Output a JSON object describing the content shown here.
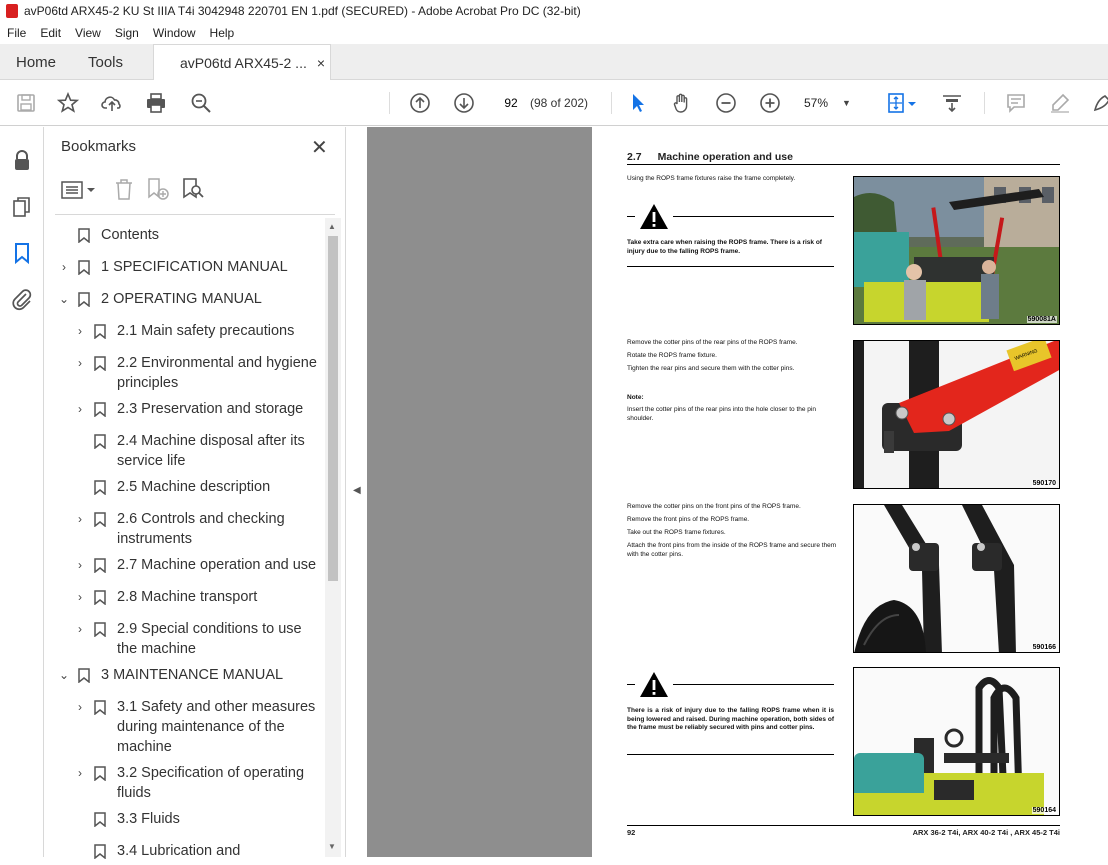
{
  "window": {
    "title": "avP06td ARX45-2 KU St IIIA T4i 3042948 220701 EN 1.pdf (SECURED) - Adobe Acrobat Pro DC (32-bit)"
  },
  "menu": [
    "File",
    "Edit",
    "View",
    "Sign",
    "Window",
    "Help"
  ],
  "tabs": {
    "home": "Home",
    "tools": "Tools",
    "document": "avP06td ARX45-2 ...",
    "close_glyph": "×"
  },
  "toolbar": {
    "page_value": "92",
    "page_count": "(98 of 202)",
    "zoom": "57%",
    "zoom_caret": "▼"
  },
  "bookmarks": {
    "title": "Bookmarks",
    "close_glyph": "✕",
    "items": [
      {
        "label": "Contents",
        "expander": ""
      },
      {
        "label": "1 SPECIFICATION MANUAL",
        "expander": "›"
      },
      {
        "label": "2 OPERATING MANUAL",
        "expander": "⌄"
      },
      {
        "label": "2.1 Main safety precautions",
        "expander": "›"
      },
      {
        "label": "2.2 Environmental and hygiene",
        "label2": "principles",
        "expander": "›"
      },
      {
        "label": "2.3 Preservation and storage",
        "expander": "›"
      },
      {
        "label": "2.4 Machine disposal after its",
        "label2": "service life",
        "expander": ""
      },
      {
        "label": "2.5 Machine description",
        "expander": ""
      },
      {
        "label": "2.6 Controls and checking",
        "label2": "instruments",
        "expander": "›"
      },
      {
        "label": "2.7 Machine operation and use",
        "expander": "›"
      },
      {
        "label": "2.8 Machine transport",
        "expander": "›"
      },
      {
        "label": "2.9 Special conditions to use",
        "label2": "the machine",
        "expander": "›"
      },
      {
        "label": "3 MAINTENANCE MANUAL",
        "expander": "⌄"
      },
      {
        "label": "3.1 Safety and other measures",
        "label2": "during maintenance of the",
        "label3": "machine",
        "expander": "›"
      },
      {
        "label": "3.2 Specification of operating",
        "label2": "fluids",
        "expander": "›"
      },
      {
        "label": "3.3 Fluids",
        "expander": ""
      },
      {
        "label": "3.4 Lubrication and",
        "expander": ""
      }
    ]
  },
  "page": {
    "section_number": "2.7",
    "section_title": "Machine operation and use",
    "intro": "Using the ROPS frame fixtures raise the frame completely.",
    "warning1": "Take extra care when raising the ROPS frame. There is a risk of injury due to the falling ROPS frame.",
    "step2_line1": "Remove the cotter pins of the rear pins of the ROPS frame.",
    "step2_line2": "Rotate the ROPS frame fixture.",
    "step2_line3": "Tighten the rear pins and secure them with the cotter pins.",
    "note_label": "Note:",
    "note_text": "Insert the cotter pins of the rear pins into the hole closer to the pin shoulder.",
    "step3_line1": "Remove the cotter pins on the front pins of the ROPS frame.",
    "step3_line2": "Remove the front pins of the ROPS frame.",
    "step3_line3": "Take out the ROPS frame fixtures.",
    "step3_line4": "Attach the front pins from the inside of the ROPS frame and secure them with the cotter pins.",
    "warning2": "There is a risk of injury due to the falling ROPS frame when it is being lowered and raised. During machine operation, both sides of the frame must be reliably secured with pins and cotter pins.",
    "photo_codes": [
      "590081A",
      "590170",
      "590166",
      "590164"
    ],
    "sticker_text": "WARNING",
    "footer_page": "92",
    "footer_models": "ARX 36-2 T4i, ARX 40-2 T4i , ARX 45-2 T4i"
  },
  "colors": {
    "accent": "#1473e6",
    "rops_red": "#e3261c",
    "frame_black": "#1e1e1e",
    "machine_teal": "#3aa29a",
    "machine_yellow": "#c7d52d",
    "viewport_gray": "#8e8e8e"
  },
  "icons": {
    "rail": [
      "lock-icon",
      "copy-pages-icon",
      "bookmark-icon",
      "paperclip-icon"
    ],
    "toolbar": [
      "save-icon",
      "star-icon",
      "upload-icon",
      "print-icon",
      "zoom-search-icon",
      "prev-page-icon",
      "next-page-icon",
      "select-arrow-icon",
      "hand-icon",
      "zoom-out-icon",
      "zoom-in-icon",
      "fit-page-icon",
      "scroll-mode-icon",
      "comment-icon",
      "highlight-icon",
      "draw-icon"
    ]
  }
}
